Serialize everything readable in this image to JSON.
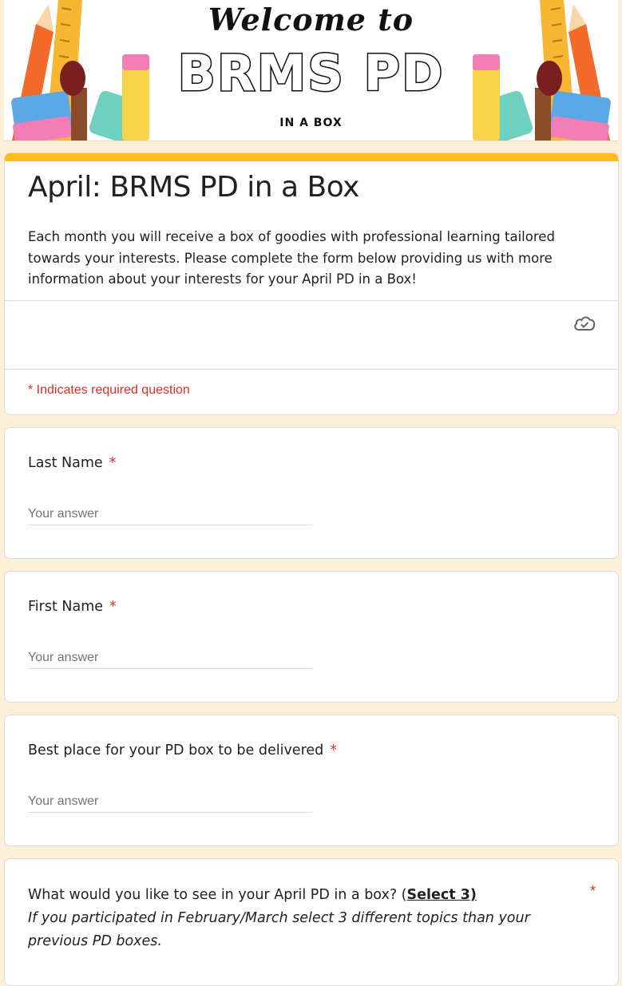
{
  "banner": {
    "script_text": "Welcome to",
    "title": "BRMS PD",
    "subtitle": "IN A BOX"
  },
  "form": {
    "title": "April: BRMS PD in a Box",
    "description": "Each month you will receive a box of goodies with professional learning tailored towards your interests. Please complete the form below providing us with more information about your interests for your April PD in a Box!",
    "required_note": "* Indicates required question",
    "accent_color": "#fbbc1e",
    "required_color": "#d93025",
    "status_icon": "cloud-check-icon"
  },
  "questions": [
    {
      "label": "Last Name",
      "required_mark": "*",
      "placeholder": "Your answer"
    },
    {
      "label": "First Name",
      "required_mark": "*",
      "placeholder": "Your answer"
    },
    {
      "label": "Best place for your PD box to be delivered",
      "required_mark": "*",
      "placeholder": "Your answer"
    },
    {
      "label_prefix": "What would you like to see in your April PD in a box? (",
      "label_emphasis": "Select 3)",
      "hint": "If you participated in February/March select 3 different topics than your previous PD boxes.",
      "required_mark": "*"
    }
  ]
}
